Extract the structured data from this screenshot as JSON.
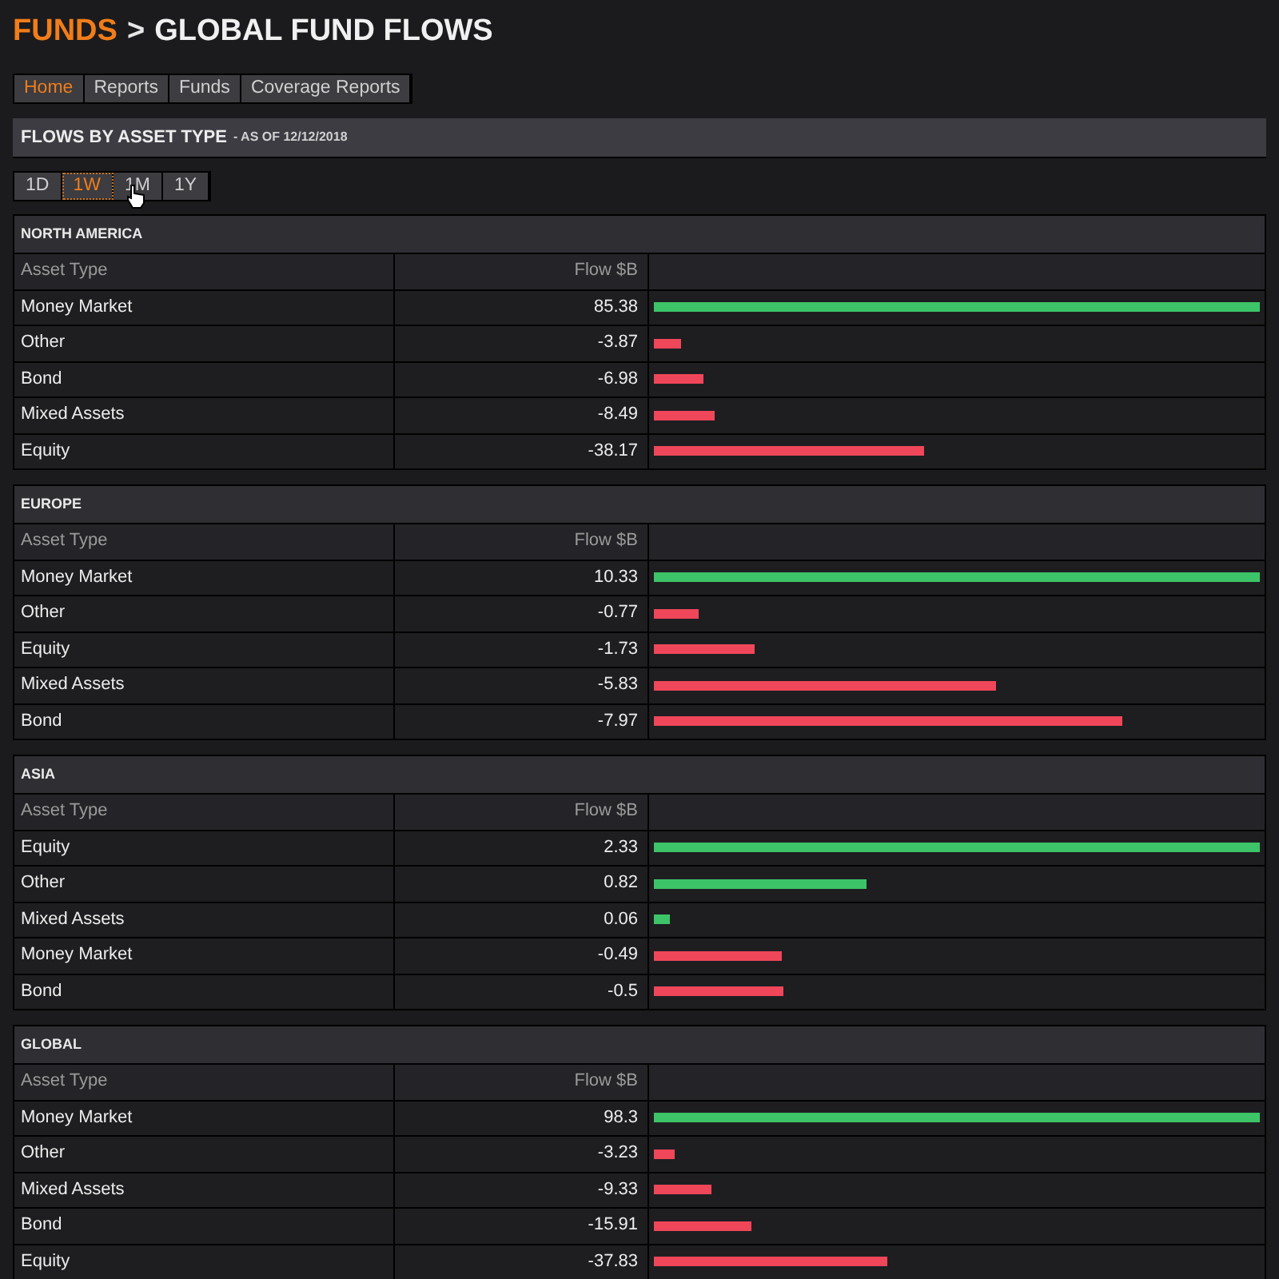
{
  "breadcrumb": {
    "section": "FUNDS",
    "separator": ">",
    "page": "GLOBAL FUND FLOWS"
  },
  "nav_tabs": [
    {
      "label": "Home",
      "selected": true
    },
    {
      "label": "Reports",
      "selected": false
    },
    {
      "label": "Funds",
      "selected": false
    },
    {
      "label": "Coverage Reports",
      "selected": false
    }
  ],
  "panel": {
    "title": "FLOWS BY ASSET TYPE",
    "subtitle": "- AS OF 12/12/2018"
  },
  "periods": [
    {
      "label": "1D",
      "selected": false
    },
    {
      "label": "1W",
      "selected": true
    },
    {
      "label": "1M",
      "selected": false
    },
    {
      "label": "1Y",
      "selected": false
    }
  ],
  "regions": [
    {
      "name": "NORTH AMERICA",
      "columns": [
        "Asset Type",
        "Flow $B"
      ],
      "rows": [
        {
          "asset": "Money Market",
          "flow": "85.38",
          "level": 1,
          "color": "#3dc468"
        },
        {
          "asset": "Other",
          "flow": "-3.87",
          "level": 0.045,
          "color": "#f0465a"
        },
        {
          "asset": "Bond",
          "flow": "-6.98",
          "level": 0.082,
          "color": "#f0465a"
        },
        {
          "asset": "Mixed Assets",
          "flow": "-8.49",
          "level": 0.099,
          "color": "#f0465a"
        },
        {
          "asset": "Equity",
          "flow": "-38.17",
          "level": 0.447,
          "color": "#f0465a"
        }
      ]
    },
    {
      "name": "EUROPE",
      "columns": [
        "Asset Type",
        "Flow $B"
      ],
      "rows": [
        {
          "asset": "Money Market",
          "flow": "10.33",
          "level": 1,
          "color": "#3dc468"
        },
        {
          "asset": "Other",
          "flow": "-0.77",
          "level": 0.075,
          "color": "#f0465a"
        },
        {
          "asset": "Equity",
          "flow": "-1.73",
          "level": 0.167,
          "color": "#f0465a"
        },
        {
          "asset": "Mixed Assets",
          "flow": "-5.83",
          "level": 0.564,
          "color": "#f0465a"
        },
        {
          "asset": "Bond",
          "flow": "-7.97",
          "level": 0.772,
          "color": "#f0465a"
        }
      ]
    },
    {
      "name": "ASIA",
      "columns": [
        "Asset Type",
        "Flow $B"
      ],
      "rows": [
        {
          "asset": "Equity",
          "flow": "2.33",
          "level": 1,
          "color": "#3dc468"
        },
        {
          "asset": "Other",
          "flow": "0.82",
          "level": 0.352,
          "color": "#3dc468"
        },
        {
          "asset": "Mixed Assets",
          "flow": "0.06",
          "level": 0.026,
          "color": "#3dc468"
        },
        {
          "asset": "Money Market",
          "flow": "-0.49",
          "level": 0.21,
          "color": "#f0465a"
        },
        {
          "asset": "Bond",
          "flow": "-0.5",
          "level": 0.215,
          "color": "#f0465a"
        }
      ]
    },
    {
      "name": "GLOBAL",
      "columns": [
        "Asset Type",
        "Flow $B"
      ],
      "rows": [
        {
          "asset": "Money Market",
          "flow": "98.3",
          "level": 1,
          "color": "#3dc468"
        },
        {
          "asset": "Other",
          "flow": "-3.23",
          "level": 0.033,
          "color": "#f0465a"
        },
        {
          "asset": "Mixed Assets",
          "flow": "-9.33",
          "level": 0.095,
          "color": "#f0465a"
        },
        {
          "asset": "Bond",
          "flow": "-15.91",
          "level": 0.162,
          "color": "#f0465a"
        },
        {
          "asset": "Equity",
          "flow": "-37.83",
          "level": 0.385,
          "color": "#f0465a"
        }
      ]
    }
  ]
}
